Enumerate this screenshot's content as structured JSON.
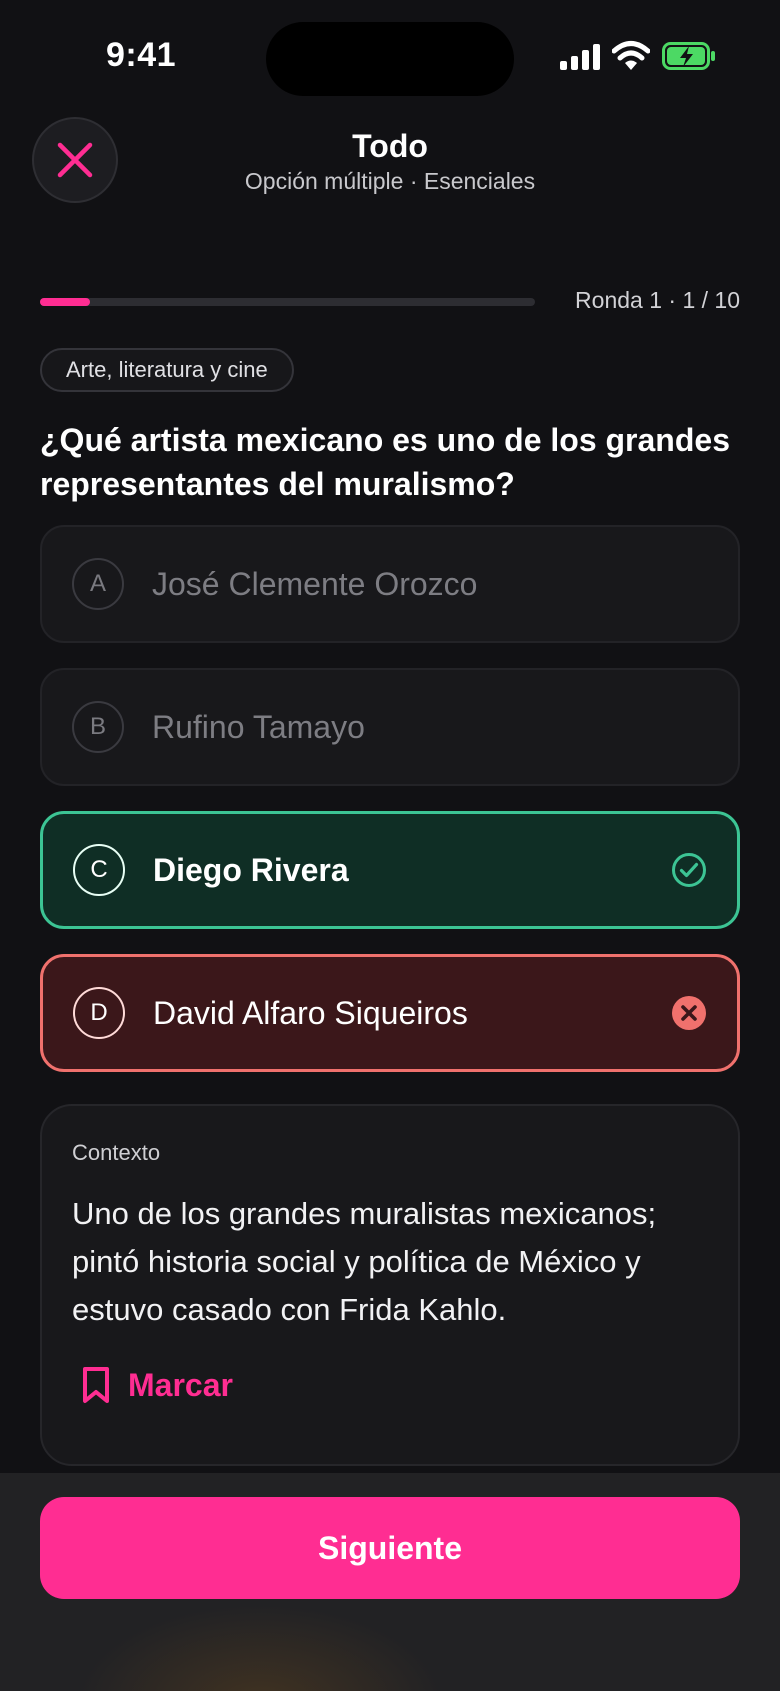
{
  "status_bar": {
    "time": "9:41"
  },
  "header": {
    "title": "Todo",
    "subtitle": "Opción múltiple · Esenciales"
  },
  "progress": {
    "label": "Ronda 1 · 1 / 10",
    "fraction": 0.1
  },
  "category": "Arte, literatura y cine",
  "question": "¿Qué artista mexicano es uno de los grandes representantes del muralismo?",
  "options": [
    {
      "letter": "A",
      "text": "José Clemente Orozco",
      "state": "neutral"
    },
    {
      "letter": "B",
      "text": "Rufino Tamayo",
      "state": "neutral"
    },
    {
      "letter": "C",
      "text": "Diego Rivera",
      "state": "correct"
    },
    {
      "letter": "D",
      "text": "David Alfaro Siqueiros",
      "state": "wrong"
    }
  ],
  "context": {
    "label": "Contexto",
    "text": "Uno de los grandes muralistas mexicanos; pintó historia social y política de México y estuvo casado con Frida Kahlo.",
    "bookmark_label": "Marcar"
  },
  "next_label": "Siguiente",
  "colors": {
    "accent": "#ff2d92",
    "correct": "#3cc494",
    "wrong": "#f0716d",
    "background": "#111114"
  },
  "icons": [
    "close-icon",
    "signal-icon",
    "wifi-icon",
    "battery-icon",
    "check-circle-icon",
    "x-circle-icon",
    "bookmark-icon"
  ]
}
